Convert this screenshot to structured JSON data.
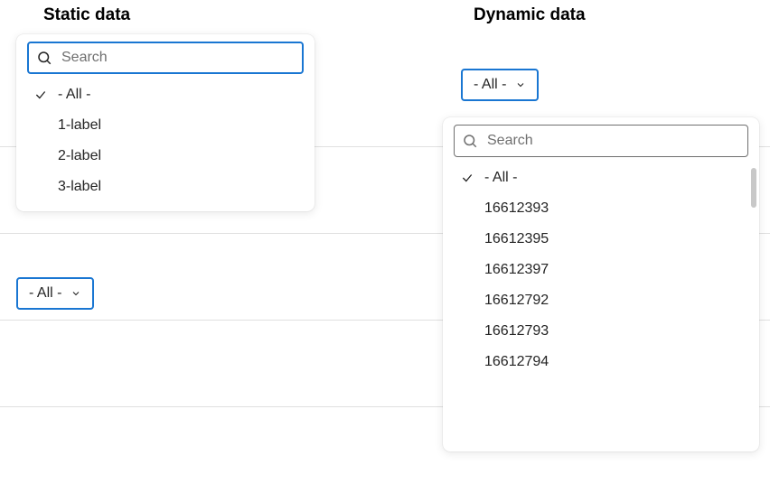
{
  "colors": {
    "accent": "#1976d2",
    "placeholder": "#6f6f6f"
  },
  "static": {
    "title": "Static data",
    "search": {
      "placeholder": "Search",
      "value": ""
    },
    "items": [
      {
        "label": "- All -",
        "selected": true
      },
      {
        "label": "1-label",
        "selected": false
      },
      {
        "label": "2-label",
        "selected": false
      },
      {
        "label": "3-label",
        "selected": false
      }
    ],
    "dropdown_label": "- All -"
  },
  "dynamic": {
    "title": "Dynamic data",
    "dropdown_label": "- All -",
    "search": {
      "placeholder": "Search",
      "value": ""
    },
    "items": [
      {
        "label": "- All -",
        "selected": true
      },
      {
        "label": "16612393",
        "selected": false
      },
      {
        "label": "16612395",
        "selected": false
      },
      {
        "label": "16612397",
        "selected": false
      },
      {
        "label": "16612792",
        "selected": false
      },
      {
        "label": "16612793",
        "selected": false
      },
      {
        "label": "16612794",
        "selected": false
      }
    ]
  }
}
